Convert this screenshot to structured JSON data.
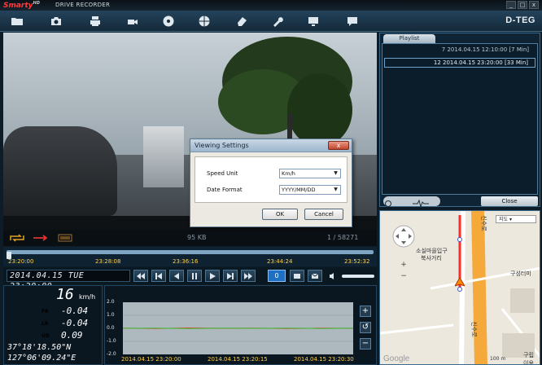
{
  "titlebar": {
    "brand": "Smarty",
    "brand_sup": "HD",
    "title": "DRIVE RECORDER",
    "minimize": "_",
    "maximize": "□",
    "close": "x"
  },
  "toolbar": {
    "logo": "D-TEG",
    "icons": [
      "folder-icon",
      "camera-icon",
      "printer-icon",
      "capture-icon",
      "disc-icon",
      "globe-icon",
      "eraser-icon",
      "wrench-icon",
      "monitor-icon",
      "chat-icon"
    ]
  },
  "video": {
    "file_size": "95 KB",
    "frame": "1 / 58271"
  },
  "dialog": {
    "title": "Viewing Settings",
    "close": "x",
    "speed_unit_label": "Speed Unit",
    "speed_unit_value": "Km/h",
    "date_format_label": "Date Format",
    "date_format_value": "YYYY/MM/DD",
    "ok": "OK",
    "cancel": "Cancel"
  },
  "timeline": {
    "ticks": [
      "23:20:00",
      "23:28:08",
      "23:36:16",
      "23:44:24",
      "23:52:32"
    ],
    "position": 0.0
  },
  "controls": {
    "clock": "2014.04.15 TUE 23:20:00",
    "speed_box": "0",
    "volume": 1.0
  },
  "stats": {
    "speed": "16",
    "speed_unit": "km/h",
    "gsensor": [
      {
        "label": "FR",
        "value": "-0.04",
        "color": "#ff4040"
      },
      {
        "label": "LR",
        "value": "-0.04",
        "color": "#30d030"
      },
      {
        "label": "UD",
        "value": "0.09",
        "color": "#4070ff"
      }
    ],
    "lat": "37°18'18.50\"N",
    "lon": "127°06'09.24\"E"
  },
  "chart_data": {
    "type": "line",
    "ylim": [
      -2.0,
      2.0
    ],
    "yticks": [
      "2.0",
      "1.0",
      "0.0",
      "-1.0",
      "-2.0"
    ],
    "xticks": [
      "2014.04.15 23:20:00",
      "2014.04.15 23:20:15",
      "2014.04.15 23:20:30"
    ],
    "series": [
      {
        "values": [
          0.02,
          -0.01,
          0.03,
          0.0,
          0.02,
          -0.02,
          0.01,
          0.0
        ],
        "color": "#ff3030"
      },
      {
        "values": [
          0.0,
          0.02,
          -0.01,
          0.01,
          0.0,
          0.02,
          -0.01,
          0.01
        ],
        "color": "#30c030"
      }
    ]
  },
  "graph_buttons": [
    "+",
    "↺",
    "−"
  ],
  "playlist": {
    "tab": "Playlist",
    "items": [
      {
        "text": "7  2014.04.15 12:10:00 [7 Min]",
        "selected": false
      },
      {
        "text": "12  2014.04.15 23:20:00 [33 Min]",
        "selected": true
      }
    ],
    "close": "Close"
  },
  "map": {
    "map_type": "지도",
    "labels": [
      "소실마을입구",
      "북사거리",
      "구성터미",
      "신수로",
      "신수로",
      "100 m",
      "Google",
      "구립",
      "이용"
    ]
  }
}
